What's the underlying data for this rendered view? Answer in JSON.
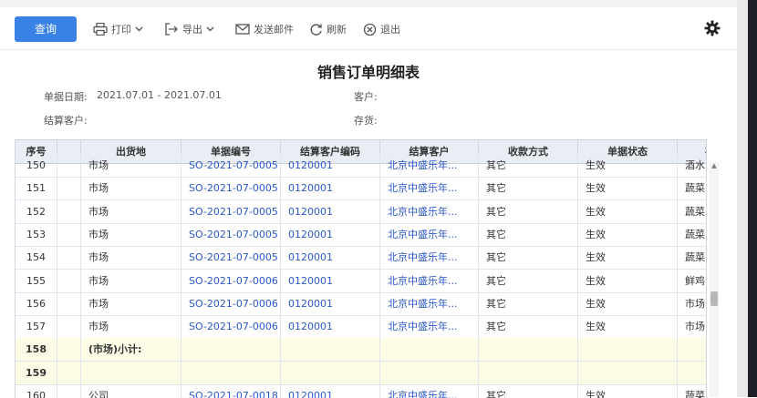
{
  "toolbar": {
    "query": "查询",
    "print": "打印",
    "export": "导出",
    "email": "发送邮件",
    "refresh": "刷新",
    "exit": "退出"
  },
  "report": {
    "title": "销售订单明细表",
    "date_label": "单据日期:",
    "date_value": "2021.07.01 - 2021.07.01",
    "customer_label": "客户:",
    "settle_label": "结算客户:",
    "stock_label": "存货:"
  },
  "table": {
    "headers": [
      "序号",
      "",
      "出货地",
      "单据编号",
      "结算客户编码",
      "结算客户",
      "收款方式",
      "单据状态",
      "存"
    ],
    "rows": [
      {
        "seq": "150",
        "place": "市场",
        "doc": "SO-2021-07-0005",
        "code": "0120001",
        "cust": "北京中盛乐年...",
        "pay": "其它",
        "status": "生效",
        "stock": "酒水"
      },
      {
        "seq": "151",
        "place": "市场",
        "doc": "SO-2021-07-0005",
        "code": "0120001",
        "cust": "北京中盛乐年...",
        "pay": "其它",
        "status": "生效",
        "stock": "蔬菜"
      },
      {
        "seq": "152",
        "place": "市场",
        "doc": "SO-2021-07-0005",
        "code": "0120001",
        "cust": "北京中盛乐年...",
        "pay": "其它",
        "status": "生效",
        "stock": "蔬菜"
      },
      {
        "seq": "153",
        "place": "市场",
        "doc": "SO-2021-07-0005",
        "code": "0120001",
        "cust": "北京中盛乐年...",
        "pay": "其它",
        "status": "生效",
        "stock": "蔬菜"
      },
      {
        "seq": "154",
        "place": "市场",
        "doc": "SO-2021-07-0005",
        "code": "0120001",
        "cust": "北京中盛乐年...",
        "pay": "其它",
        "status": "生效",
        "stock": "蔬菜"
      },
      {
        "seq": "155",
        "place": "市场",
        "doc": "SO-2021-07-0006",
        "code": "0120001",
        "cust": "北京中盛乐年...",
        "pay": "其它",
        "status": "生效",
        "stock": "鲜鸡"
      },
      {
        "seq": "156",
        "place": "市场",
        "doc": "SO-2021-07-0006",
        "code": "0120001",
        "cust": "北京中盛乐年...",
        "pay": "其它",
        "status": "生效",
        "stock": "市场"
      },
      {
        "seq": "157",
        "place": "市场",
        "doc": "SO-2021-07-0006",
        "code": "0120001",
        "cust": "北京中盛乐年...",
        "pay": "其它",
        "status": "生效",
        "stock": "市场"
      },
      {
        "seq": "158",
        "place": "(市场)小计:",
        "doc": "",
        "code": "",
        "cust": "",
        "pay": "",
        "status": "",
        "stock": "",
        "subtotal": true
      },
      {
        "seq": "159",
        "place": "",
        "doc": "",
        "code": "",
        "cust": "",
        "pay": "",
        "status": "",
        "stock": "",
        "subtotal": true
      },
      {
        "seq": "160",
        "place": "公司",
        "doc": "SO-2021-07-0018",
        "code": "0120001",
        "cust": "北京中盛乐年...",
        "pay": "其它",
        "status": "生效",
        "stock": "蔬菜"
      }
    ]
  },
  "icons": {
    "print": "printer-icon",
    "export": "export-icon",
    "email": "mail-icon",
    "refresh": "refresh-icon",
    "exit": "close-circle-icon",
    "settings": "gear-icon"
  },
  "colors": {
    "accent": "#3b82e6",
    "link": "#2a57c9",
    "subtotal_bg": "#fbfbe6",
    "header_bg": "#e9eef5",
    "active_tab": "#e04b3a"
  }
}
